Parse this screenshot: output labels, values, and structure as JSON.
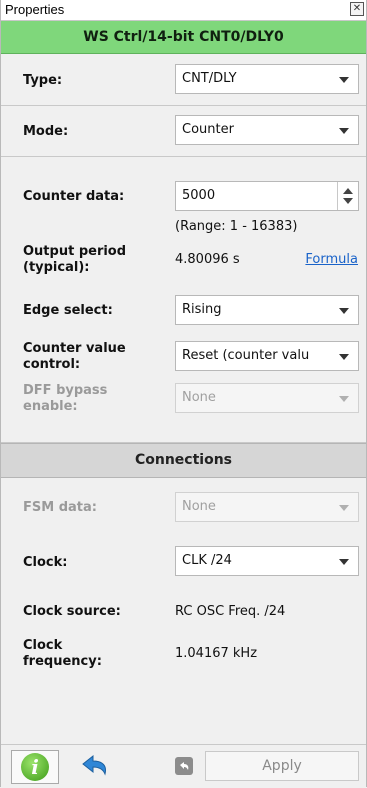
{
  "window": {
    "title": "Properties",
    "close_glyph": "✕"
  },
  "block": {
    "title": "WS Ctrl/14-bit CNT0/DLY0"
  },
  "type": {
    "label": "Type:",
    "value": "CNT/DLY"
  },
  "mode": {
    "label": "Mode:",
    "value": "Counter"
  },
  "counter": {
    "label": "Counter data:",
    "value": "5000",
    "range": "(Range:  1 - 16383)"
  },
  "output_period": {
    "label_line1": "Output period",
    "label_line2": "(typical):",
    "value": "4.80096 s",
    "link": "Formula"
  },
  "edge_select": {
    "label": "Edge select:",
    "value": "Rising"
  },
  "counter_value_control": {
    "label_line1": "Counter value",
    "label_line2": "control:",
    "value": "Reset (counter valu"
  },
  "dff_bypass": {
    "label_line1": "DFF bypass",
    "label_line2": "enable:",
    "value": "None"
  },
  "connections": {
    "title": "Connections"
  },
  "fsm_data": {
    "label": "FSM data:",
    "value": "None"
  },
  "clock": {
    "label": "Clock:",
    "value": "CLK /24"
  },
  "clock_source": {
    "label": "Clock source:",
    "value": "RC OSC Freq. /24"
  },
  "clock_frequency": {
    "label_line1": "Clock",
    "label_line2": "frequency:",
    "value": "1.04167 kHz"
  },
  "footer": {
    "info_glyph": "i",
    "apply_label": "Apply"
  },
  "colors": {
    "header_green": "#7fd77b",
    "link_blue": "#1a63c9",
    "info_green": "#3b9a16",
    "undo_blue": "#2f86d6"
  }
}
